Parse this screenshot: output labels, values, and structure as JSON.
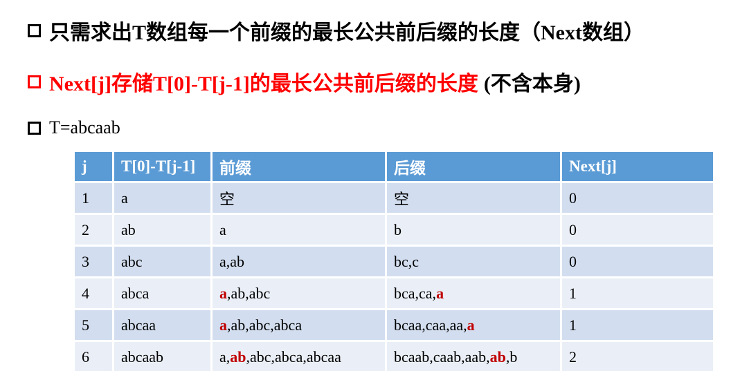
{
  "bullets": {
    "b1": "只需求出T数组每一个前缀的最长公共前后缀的长度（Next数组）",
    "b2_red": "Next[j]存储T[0]-T[j-1]的最长公共前后缀的长度",
    "b2_black": "(不含本身)",
    "b3": "T=abcaab"
  },
  "table": {
    "headers": [
      "j",
      "T[0]-T[j-1]",
      "前缀",
      "后缀",
      "Next[j]"
    ],
    "rows": [
      {
        "j": "1",
        "sub": "a",
        "prefix": [
          {
            "t": "空"
          }
        ],
        "suffix": [
          {
            "t": "空"
          }
        ],
        "next": "0"
      },
      {
        "j": "2",
        "sub": "ab",
        "prefix": [
          {
            "t": "a"
          }
        ],
        "suffix": [
          {
            "t": "b"
          }
        ],
        "next": "0"
      },
      {
        "j": "3",
        "sub": "abc",
        "prefix": [
          {
            "t": "a,ab"
          }
        ],
        "suffix": [
          {
            "t": "bc,c"
          }
        ],
        "next": "0"
      },
      {
        "j": "4",
        "sub": "abca",
        "prefix": [
          {
            "t": "a",
            "hl": true
          },
          {
            "t": ",ab,abc"
          }
        ],
        "suffix": [
          {
            "t": "bca,ca,"
          },
          {
            "t": "a",
            "hl": true
          }
        ],
        "next": "1"
      },
      {
        "j": "5",
        "sub": "abcaa",
        "prefix": [
          {
            "t": "a",
            "hl": true
          },
          {
            "t": ",ab,abc,abca"
          }
        ],
        "suffix": [
          {
            "t": "bcaa,caa,aa,"
          },
          {
            "t": "a",
            "hl": true
          }
        ],
        "next": "1"
      },
      {
        "j": "6",
        "sub": "abcaab",
        "prefix": [
          {
            "t": "a,"
          },
          {
            "t": "ab",
            "hl": true
          },
          {
            "t": ",abc,abca,abcaa"
          }
        ],
        "suffix": [
          {
            "t": "bcaab,caab,aab,"
          },
          {
            "t": "ab",
            "hl": true
          },
          {
            "t": ",b"
          }
        ],
        "next": "2"
      }
    ]
  },
  "colors": {
    "header_bg": "#5b9bd5",
    "row_odd": "#d2deef",
    "row_even": "#eaeff7",
    "highlight": "#c00000",
    "bullet2": "#ff0000"
  }
}
